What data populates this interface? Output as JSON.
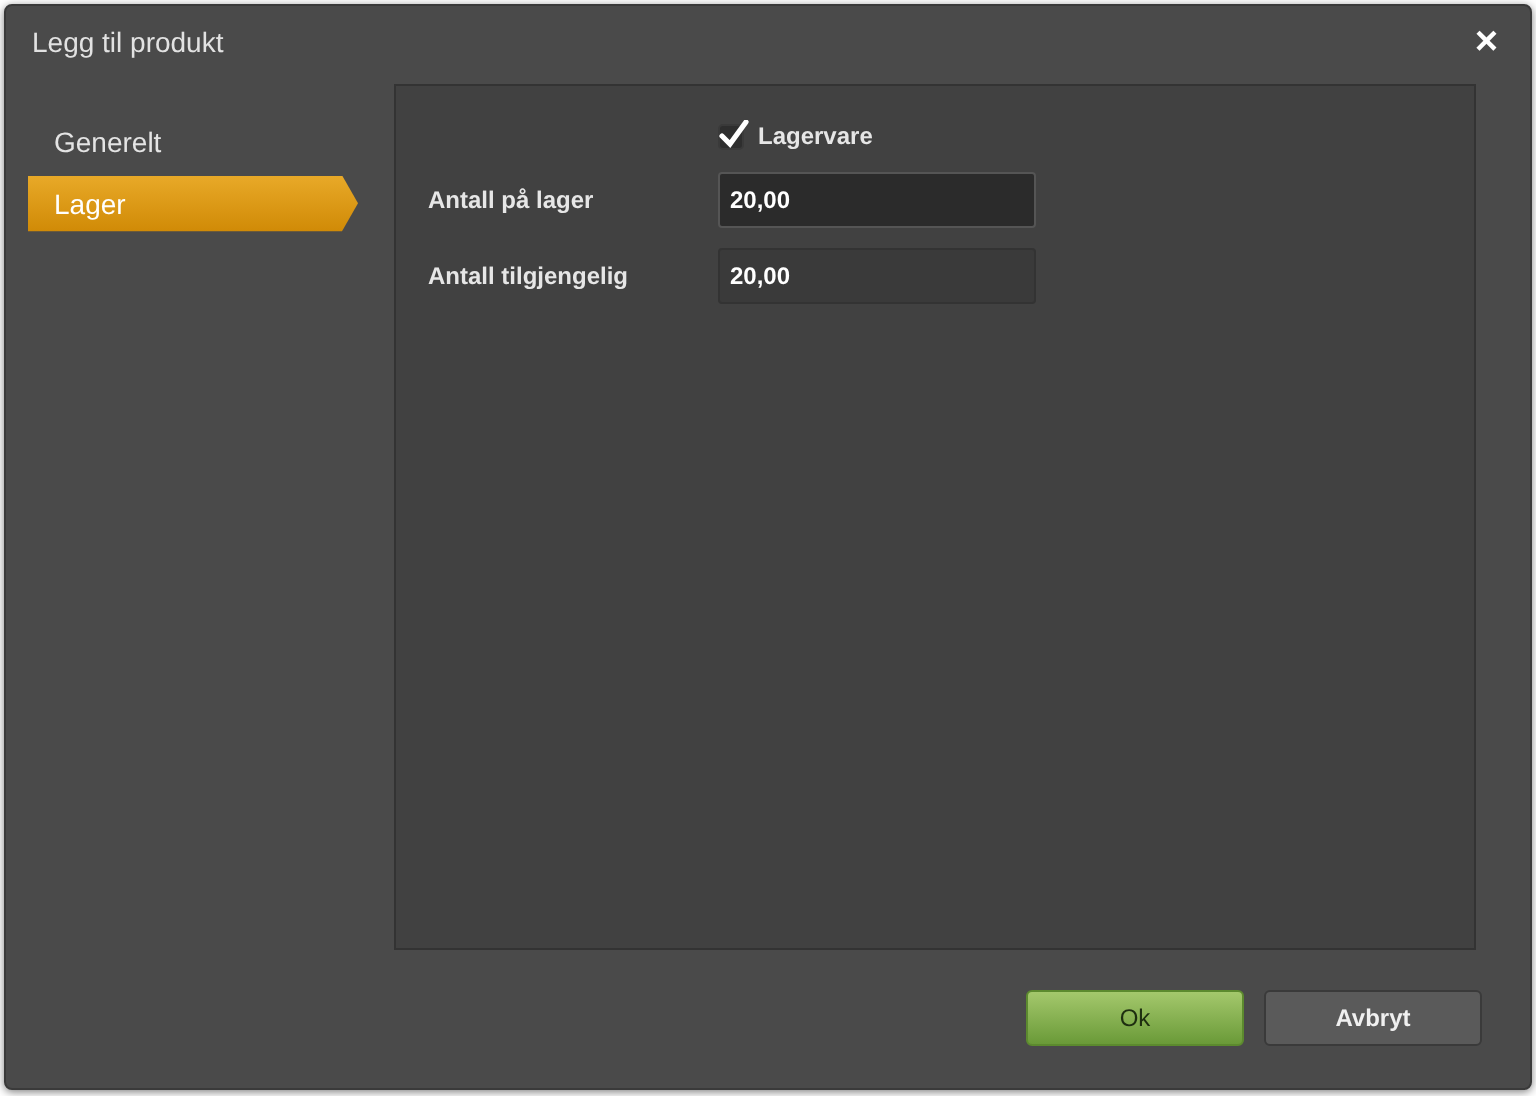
{
  "window": {
    "title": "Legg til produkt",
    "close": "×"
  },
  "sidebar": {
    "items": [
      {
        "label": "Generelt",
        "selected": false
      },
      {
        "label": "Lager",
        "selected": true
      }
    ]
  },
  "form": {
    "checkbox": {
      "label": "Lagervare",
      "checked": true
    },
    "fields": [
      {
        "label": "Antall på lager",
        "value": "20,00",
        "focused": true
      },
      {
        "label": "Antall tilgjengelig",
        "value": "20,00",
        "focused": false
      }
    ]
  },
  "buttons": [
    {
      "label": "Ok",
      "kind": "primary"
    },
    {
      "label": "Avbryt",
      "kind": "secondary"
    }
  ]
}
